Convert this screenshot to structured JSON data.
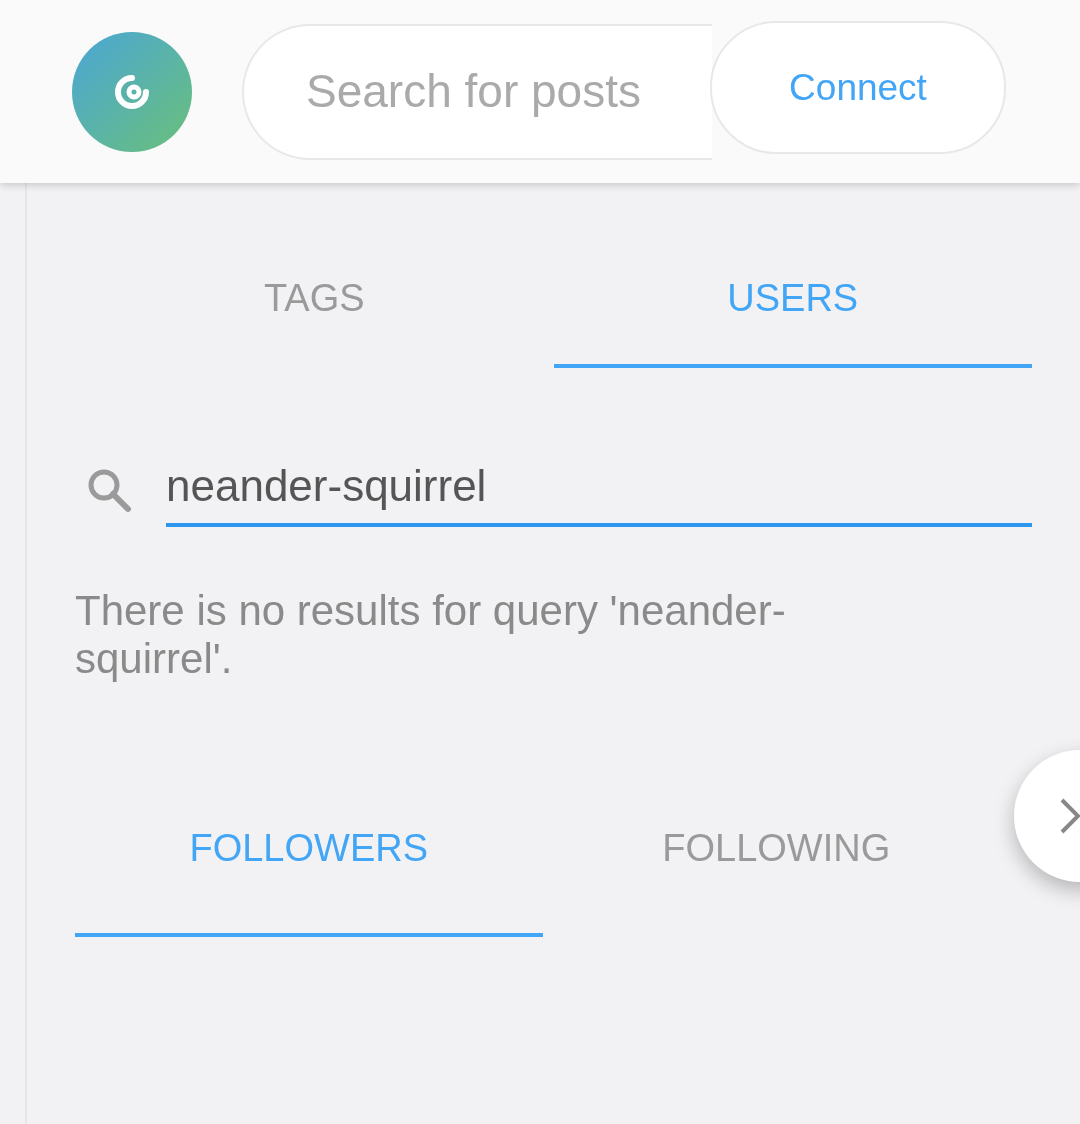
{
  "header": {
    "search": {
      "placeholder": "Search for posts"
    },
    "connect_button": "Connect"
  },
  "search_tabs": [
    {
      "label": "TAGS",
      "selected": false
    },
    {
      "label": "USERS",
      "selected": true
    }
  ],
  "user_search": {
    "value": "neander-squirrel"
  },
  "message": "There is no results for query 'neander-squirrel'.",
  "follow_tabs": [
    {
      "label": "FOLLOWERS",
      "selected": true
    },
    {
      "label": "FOLLOWING",
      "selected": false
    }
  ]
}
